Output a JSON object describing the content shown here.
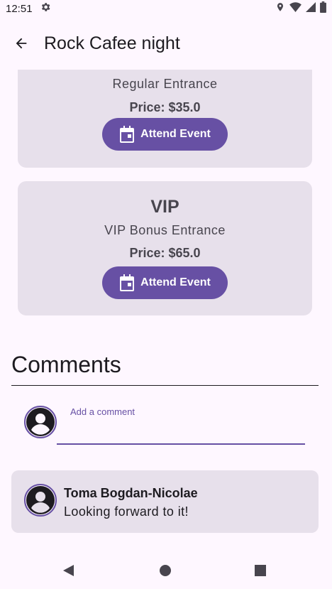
{
  "status_bar": {
    "time": "12:51"
  },
  "app_bar": {
    "title": "Rock Cafee night"
  },
  "tickets": [
    {
      "name": "",
      "description": "Regular Entrance",
      "price": "Price: $35.0",
      "button_label": "Attend Event"
    },
    {
      "name": "VIP",
      "description": "VIP Bonus Entrance",
      "price": "Price: $65.0",
      "button_label": "Attend Event"
    }
  ],
  "comments": {
    "title": "Comments",
    "input": {
      "label": "Add a comment",
      "value": ""
    },
    "items": [
      {
        "author": "Toma Bogdan-Nicolae",
        "text": "Looking forward to it!"
      }
    ]
  },
  "colors": {
    "primary": "#6750a4",
    "card": "#e7e0eb",
    "background": "#fef7ff"
  }
}
